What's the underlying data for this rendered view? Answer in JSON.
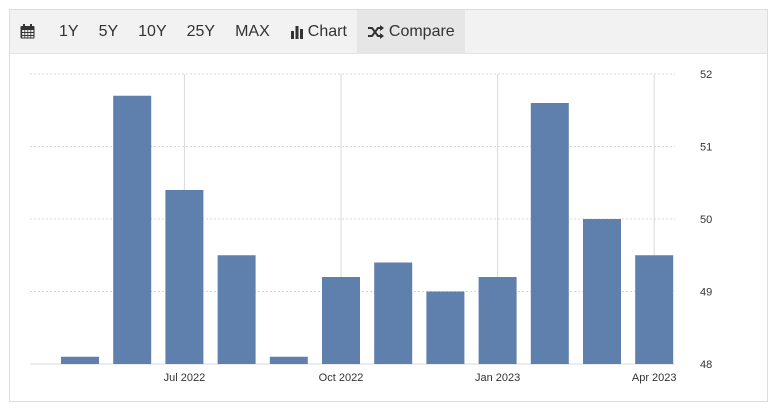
{
  "toolbar": {
    "calendar_icon": "calendar-icon",
    "ranges": [
      "1Y",
      "5Y",
      "10Y",
      "25Y",
      "MAX"
    ],
    "chart_label": "Chart",
    "chart_icon": "bar-chart-icon",
    "compare_label": "Compare",
    "compare_icon": "shuffle-icon"
  },
  "colors": {
    "bar": "#5f7fad",
    "grid": "#d8d8d8",
    "toolbar_bg": "#f2f2f2",
    "active_bg": "#e6e6e6"
  },
  "chart_data": {
    "type": "bar",
    "categories": [
      "May 2022",
      "Jun 2022",
      "Jul 2022",
      "Aug 2022",
      "Sep 2022",
      "Oct 2022",
      "Nov 2022",
      "Dec 2022",
      "Jan 2023",
      "Feb 2023",
      "Mar 2023",
      "Apr 2023"
    ],
    "values": [
      48.1,
      51.7,
      50.4,
      49.5,
      48.1,
      49.2,
      49.4,
      49.0,
      49.2,
      51.6,
      50.0,
      49.5
    ],
    "x_tick_labels": [
      "Jul 2022",
      "Oct 2022",
      "Jan 2023",
      "Apr 2023"
    ],
    "x_tick_categories": [
      "Jul 2022",
      "Oct 2022",
      "Jan 2023",
      "Apr 2023"
    ],
    "y_ticks": [
      48,
      49,
      50,
      51,
      52
    ],
    "ylim": [
      48,
      52
    ],
    "y_axis_side": "right",
    "grid": true,
    "title": "",
    "xlabel": "",
    "ylabel": ""
  }
}
